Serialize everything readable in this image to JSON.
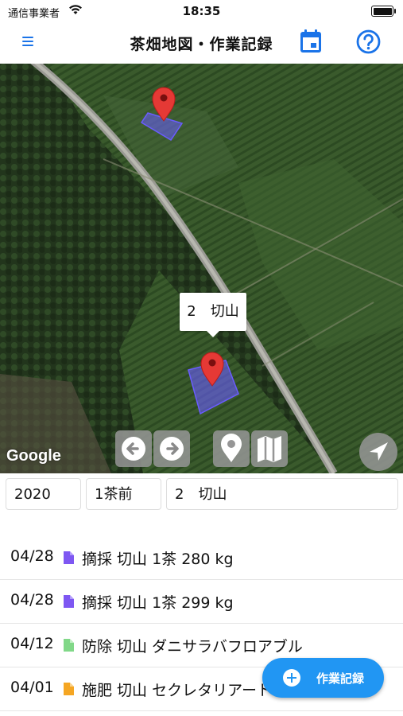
{
  "status_bar": {
    "carrier": "通信事業者",
    "time": "18:35"
  },
  "nav": {
    "title": "茶畑地図・作業記録",
    "menu_icon": "hamburger-icon",
    "calendar_icon": "calendar-icon",
    "help_icon": "help-circle-icon",
    "accent_color": "#1a73e8"
  },
  "map": {
    "info_window": "2　切山",
    "google_logo": "Google",
    "polygon_color": "#6a5cff",
    "marker_color": "#e53935",
    "controls": [
      "arrow-left-icon",
      "arrow-right-icon",
      "map-pin-icon",
      "map-icon",
      "locate-icon"
    ]
  },
  "filters": {
    "year": "2020",
    "season": "1茶前",
    "field": "2　切山"
  },
  "records": [
    {
      "date": "04/28",
      "icon": "document-icon",
      "icon_color": "#7e57f2",
      "text": "摘採  切山  1茶 280 kg"
    },
    {
      "date": "04/28",
      "icon": "document-icon",
      "icon_color": "#7e57f2",
      "text": "摘採  切山  1茶 299 kg"
    },
    {
      "date": "04/12",
      "icon": "document-icon",
      "icon_color": "#81d888",
      "text": "防除  切山  ダニサラバフロアブル"
    },
    {
      "date": "04/01",
      "icon": "document-icon",
      "icon_color": "#f5a623",
      "text": "施肥  切山  セクレタリアート"
    }
  ],
  "fab": {
    "label": "作業記録",
    "color": "#2196f3"
  }
}
